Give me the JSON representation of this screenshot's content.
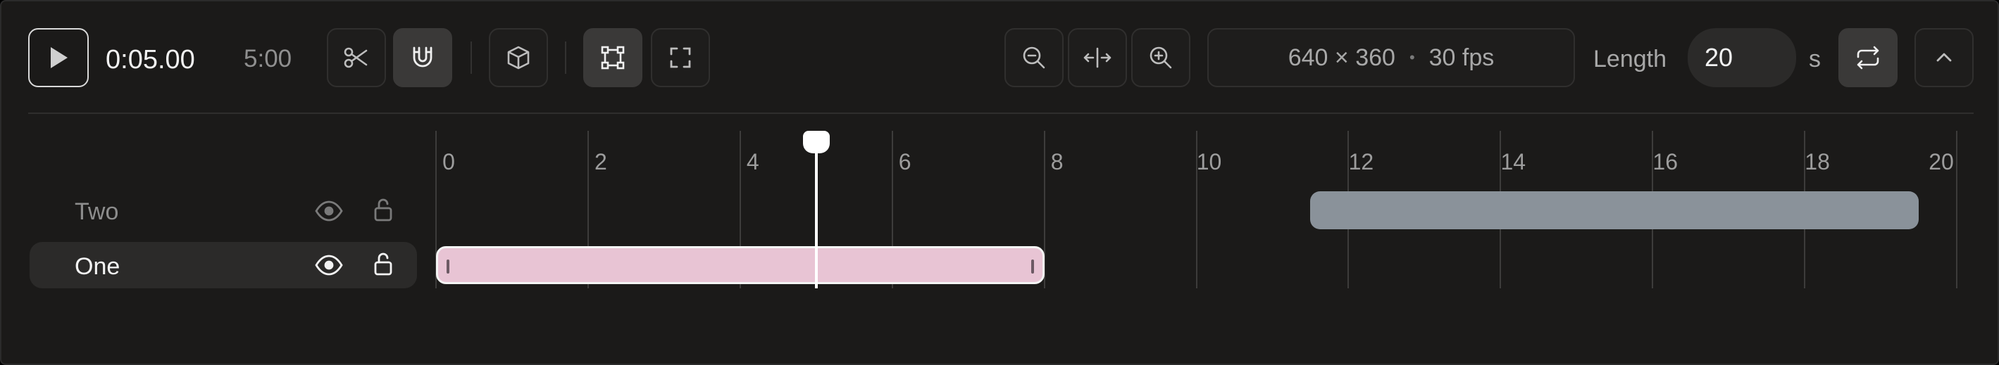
{
  "player": {
    "current_time": "0:05.00",
    "duration": "5:00"
  },
  "toolbar": {
    "play_icon": "play-icon",
    "cut_icon": "scissors-icon",
    "snap_icon": "magnet-icon",
    "object_icon": "cube-icon",
    "select_icon": "bounding-box-icon",
    "fullscreen_icon": "expand-icon",
    "zoom_out_icon": "zoom-out-icon",
    "fit_icon": "fit-width-icon",
    "zoom_in_icon": "zoom-in-icon",
    "loop_icon": "loop-icon",
    "collapse_icon": "chevron-up-icon"
  },
  "composition": {
    "resolution": "640 × 360",
    "separator": "•",
    "fps": "30 fps"
  },
  "length": {
    "label": "Length",
    "value": "20",
    "unit": "s"
  },
  "ruler": {
    "min": 0,
    "max": 20,
    "labels": [
      "0",
      "2",
      "4",
      "6",
      "8",
      "10",
      "12",
      "14",
      "16",
      "18",
      "20"
    ]
  },
  "playhead": {
    "time_seconds": 5
  },
  "tracks": [
    {
      "name": "Two",
      "selected": false,
      "visibility_icon": "eye-icon",
      "lock_icon": "unlock-icon",
      "clip": {
        "start": 11.5,
        "end": 19.5,
        "color": "#8a929a"
      }
    },
    {
      "name": "One",
      "selected": true,
      "visibility_icon": "eye-icon",
      "lock_icon": "unlock-icon",
      "clip": {
        "start": 0,
        "end": 8,
        "color": "#e8c4d4"
      }
    }
  ],
  "colors": {
    "background": "#1b1a19",
    "accent_text": "#ffffff",
    "muted_text": "#9d9d9d"
  }
}
